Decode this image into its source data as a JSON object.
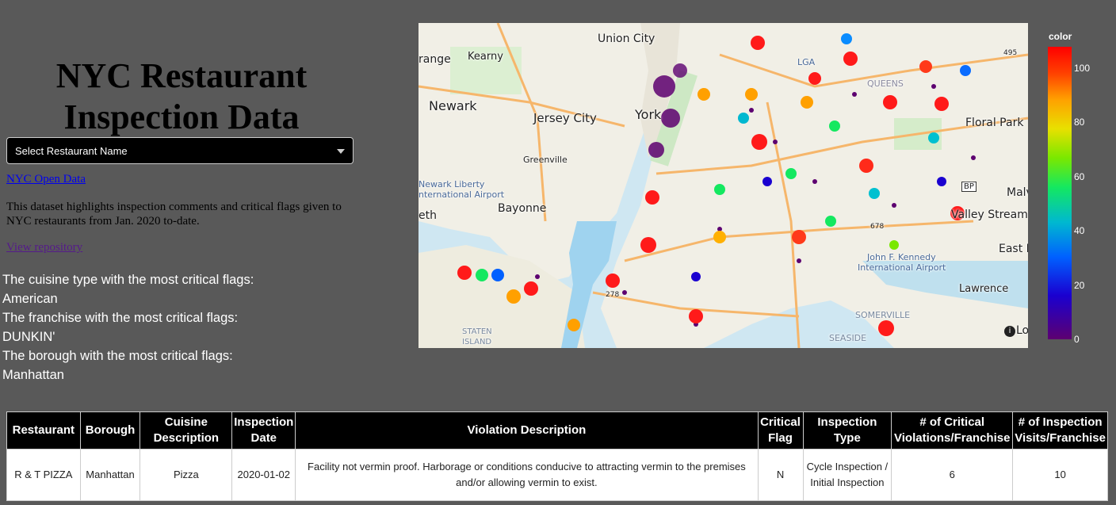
{
  "page": {
    "title": "NYC Restaurant Inspection Data",
    "dropdown_placeholder": "Select Restaurant Name",
    "open_data_link": "NYC Open Data",
    "description": "This dataset highlights inspection comments and critical flags given to NYC restaurants from Jan. 2020 to-date.",
    "repo_link": "View repository"
  },
  "stats": {
    "cuisine_label": "The cuisine type with the most critical flags:",
    "cuisine_value": "American",
    "franchise_label": "The franchise with the most critical flags:",
    "franchise_value": "DUNKIN'",
    "borough_label": "The borough with the most critical flags:",
    "borough_value": "Manhattan"
  },
  "map": {
    "labels": {
      "union_city": "Union City",
      "kearny": "Kearny",
      "orange": "range",
      "newark": "Newark",
      "jersey_city": "Jersey City",
      "greenville": "Greenville",
      "newark_airport_1": "Newark Liberty",
      "newark_airport_2": "nternational Airport",
      "bayonne": "Bayonne",
      "eth": "eth",
      "staten_1": "STATEN",
      "staten_2": "ISLAND",
      "lga": "LGA",
      "queens": "QUEENS",
      "floral_park": "Floral Park",
      "malv": "Malv",
      "valley_stream": "Valley Stream",
      "east_r": "East R",
      "jfk_1": "John F. Kennedy",
      "jfk_2": "International Airport",
      "lawrence": "Lawrence",
      "somerville": "SOMERVILLE",
      "seaside": "SEASIDE",
      "york": "York",
      "bp": "BP",
      "r495": "495",
      "r278": "278",
      "r678": "678",
      "lo": "Lo"
    },
    "colorbar": {
      "title": "color",
      "ticks": [
        "100",
        "80",
        "60",
        "40",
        "20",
        "0"
      ],
      "colors": [
        "#5d0070",
        "#1a00d0",
        "#0060ff",
        "#00b8d0",
        "#14e860",
        "#7ae800",
        "#e8e000",
        "#ffa000",
        "#ff4000",
        "#ff0000"
      ]
    }
  },
  "table": {
    "headers": [
      "Restaurant",
      "Borough",
      "Cuisine Description",
      "Inspection Date",
      "Violation Description",
      "Critical Flag",
      "Inspection Type",
      "# of Critical Violations/Franchise",
      "# of Inspection Visits/Franchise"
    ],
    "rows": [
      [
        "R & T PIZZA",
        "Manhattan",
        "Pizza",
        "2020-01-02",
        "Facility not vermin proof. Harborage or conditions conducive to attracting vermin to the premises and/or allowing vermin to exist.",
        "N",
        "Cycle Inspection / Initial Inspection",
        "6",
        "10"
      ]
    ]
  }
}
